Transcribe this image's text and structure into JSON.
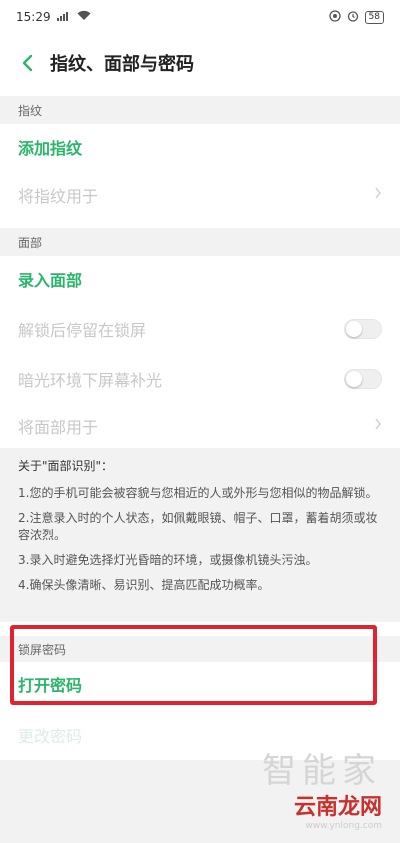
{
  "status_bar": {
    "time": "15:29",
    "battery": "58"
  },
  "header": {
    "title": "指纹、面部与密码"
  },
  "fingerprint": {
    "section_label": "指纹",
    "add_label": "添加指纹",
    "use_label": "将指纹用于"
  },
  "face": {
    "section_label": "面部",
    "enroll_label": "录入面部",
    "stay_on_lock_label": "解锁后停留在锁屏",
    "dim_fill_label": "暗光环境下屏幕补光",
    "use_label": "将面部用于"
  },
  "notes": {
    "title": "关于\"面部识别\"：",
    "items": [
      "1.您的手机可能会被容貌与您相近的人或外形与您相似的物品解锁。",
      "2.注意录入时的个人状态，如佩戴眼镜、帽子、口罩，蓄着胡须或妆容浓烈。",
      "3.录入时避免选择灯光昏暗的环境，或摄像机镜头污浊。",
      "4.确保头像清晰、易识别、提高匹配成功概率。"
    ]
  },
  "lock_password": {
    "section_label": "锁屏密码",
    "open_label": "打开密码",
    "change_label": "更改密码"
  },
  "watermark": {
    "top": "智能家",
    "main": "云南龙网",
    "url": "www.ynlong.com"
  },
  "colors": {
    "accent": "#2bb56b",
    "highlight": "#e0232e"
  }
}
